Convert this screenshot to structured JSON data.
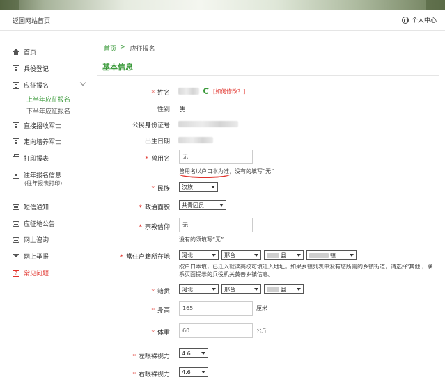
{
  "header": {
    "back_label": "返回网站首页",
    "user_label": "个人中心",
    "user_icon": "user-circle-icon"
  },
  "sidebar": {
    "items": [
      {
        "label": "首页",
        "icon": "home-icon"
      },
      {
        "label": "兵役登记",
        "icon": "register-icon"
      },
      {
        "label": "应征报名",
        "icon": "signup-icon"
      },
      {
        "label": "直接招收军士",
        "icon": "recruit-icon"
      },
      {
        "label": "定向培养军士",
        "icon": "training-icon"
      },
      {
        "label": "打印报表",
        "icon": "printer-icon"
      },
      {
        "label": "往年报名信息",
        "icon": "history-icon",
        "sub": "(往年报表打印)"
      },
      {
        "label": "短信通知",
        "icon": "message-icon"
      },
      {
        "label": "应征地公告",
        "icon": "notice-icon"
      },
      {
        "label": "网上咨询",
        "icon": "consult-icon"
      },
      {
        "label": "网上举报",
        "icon": "mail-icon"
      },
      {
        "label": "常见问题",
        "icon": "help-icon"
      }
    ],
    "subitems": [
      {
        "label": "上半年应征报名",
        "active": true
      },
      {
        "label": "下半年应征报名",
        "active": false
      }
    ]
  },
  "breadcrumb": {
    "home": "首页",
    "separator": ">",
    "current": "应征报名"
  },
  "section_title": "基本信息",
  "form": {
    "name_label": "姓名:",
    "modify_open": "[",
    "modify_link": "如何修改？",
    "modify_close": "]",
    "gender_label": "性别:",
    "gender_value": "男",
    "id_label": "公民身份证号:",
    "birth_label": "出生日期:",
    "former_name_label": "曾用名:",
    "former_name_value": "无",
    "former_name_hint_a": "曾用名以户口本为准",
    "former_name_hint_b": "，没有的填写“无”",
    "ethnicity_label": "民族:",
    "ethnicity_value": "汉族",
    "politics_label": "政治面貌:",
    "politics_value": "共青团员",
    "religion_label": "宗教信仰:",
    "religion_value": "无",
    "religion_hint": "没有的须填写“无”",
    "residence_label": "常住户籍所在地:",
    "residence_province": "河北",
    "residence_city": "邢台",
    "residence_county_suffix": "县",
    "residence_town_suffix": "镇",
    "residence_hint": "按户口本填，已迁入就读高校可填迁入地址。如果乡镇列表中没有您所需的乡镇街道，请选择'其他'，联系页面提示的兵役机关黄善乡镇信息。",
    "native_label": "籍贯:",
    "native_province": "河北",
    "native_city": "邢台",
    "native_county_suffix": "县",
    "height_label": "身高:",
    "height_value": "165",
    "height_unit": "厘米",
    "weight_label": "体重:",
    "weight_value": "60",
    "weight_unit": "公斤",
    "left_eye_label": "左眼裸视力:",
    "left_eye_value": "4.6",
    "right_eye_label": "右眼裸视力:",
    "right_eye_value": "4.6",
    "required_mark": "*"
  },
  "colors": {
    "accent_green": "#3b9a3b",
    "required_red": "#e0322b"
  }
}
